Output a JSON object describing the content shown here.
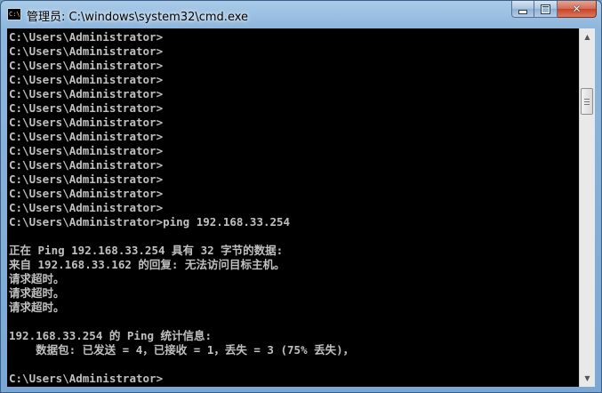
{
  "window": {
    "title": "管理员: C:\\windows\\system32\\cmd.exe",
    "icon": "cmd-icon",
    "icon_text": "C:\\",
    "buttons": {
      "minimize": "minimize-icon",
      "maximize": "maximize-icon",
      "close": "close-icon"
    }
  },
  "console": {
    "lines": [
      "C:\\Users\\Administrator>",
      "C:\\Users\\Administrator>",
      "C:\\Users\\Administrator>",
      "C:\\Users\\Administrator>",
      "C:\\Users\\Administrator>",
      "C:\\Users\\Administrator>",
      "C:\\Users\\Administrator>",
      "C:\\Users\\Administrator>",
      "C:\\Users\\Administrator>",
      "C:\\Users\\Administrator>",
      "C:\\Users\\Administrator>",
      "C:\\Users\\Administrator>",
      "C:\\Users\\Administrator>",
      "C:\\Users\\Administrator>ping 192.168.33.254",
      "",
      "正在 Ping 192.168.33.254 具有 32 字节的数据:",
      "来自 192.168.33.162 的回复: 无法访问目标主机。",
      "请求超时。",
      "请求超时。",
      "请求超时。",
      "",
      "192.168.33.254 的 Ping 统计信息:",
      "    数据包: 已发送 = 4，已接收 = 1，丢失 = 3 (75% 丢失)，",
      "",
      "C:\\Users\\Administrator>"
    ]
  },
  "colors": {
    "console_background": "#000000",
    "console_text": "#C0C0C0",
    "close_button": "#C7432A"
  }
}
